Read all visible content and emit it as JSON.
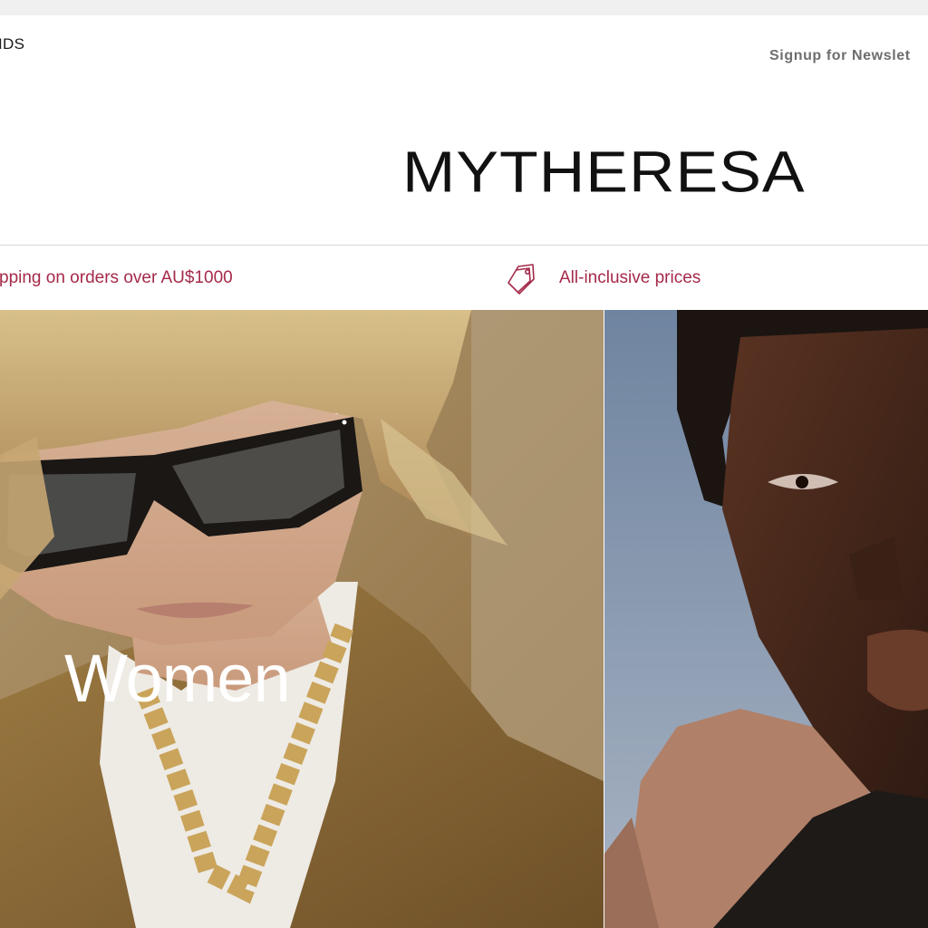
{
  "header": {
    "kids_link": "IDS",
    "newsletter_link": "Signup for Newslet",
    "logo_text": "MYTHERESA"
  },
  "usp_bar": {
    "shipping_text": "pping on orders over AU$1000",
    "prices_text": "All-inclusive prices",
    "prices_icon": "price-tag-icon",
    "accent_color": "#a52a4a"
  },
  "hero": {
    "women_label": "Women",
    "women_image": "woman-with-sunglasses-photo",
    "men_image": "man-portrait-photo"
  }
}
